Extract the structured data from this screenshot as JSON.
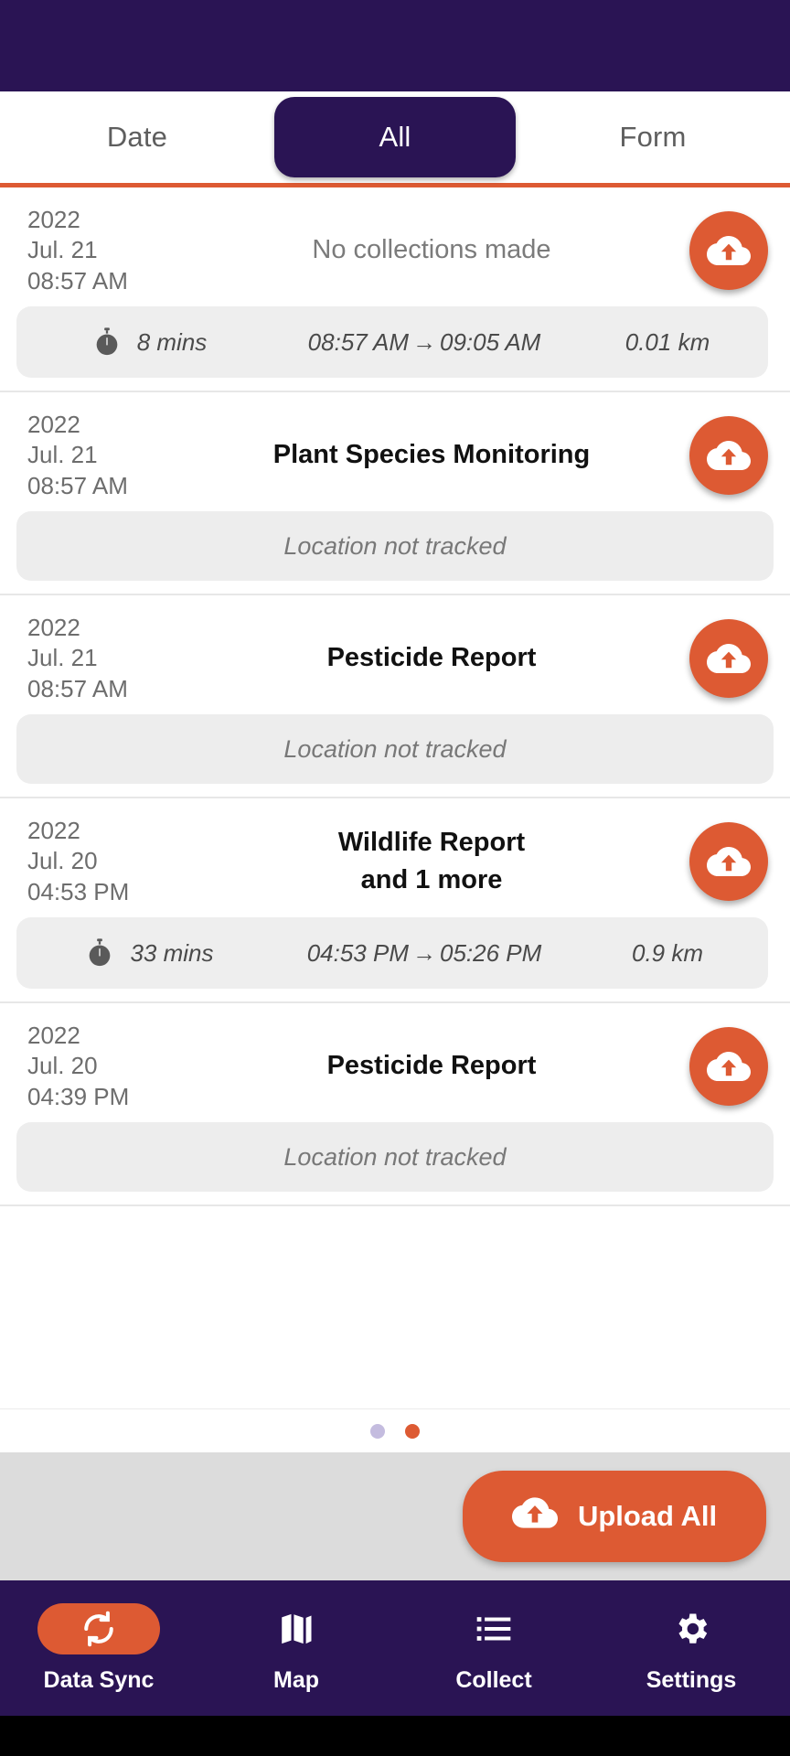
{
  "theme": {
    "primary": "#2a1454",
    "accent": "#dd5a33",
    "pill_bg": "#eeeeee",
    "bar_bg": "#dcdcdc",
    "muted_text": "#6d6d6d"
  },
  "tabs": [
    {
      "label": "Date",
      "active": false,
      "name": "tab-date"
    },
    {
      "label": "All",
      "active": true,
      "name": "tab-all"
    },
    {
      "label": "Form",
      "active": false,
      "name": "tab-form"
    }
  ],
  "records": [
    {
      "year": "2022",
      "date": "Jul. 21",
      "time": "08:57 AM",
      "title": "No collections made",
      "title_muted": true,
      "upload_icon": "cloud-upload-icon",
      "track": {
        "tracked": true,
        "icon": "stopwatch-icon",
        "duration": "8 mins",
        "start": "08:57 AM",
        "arrow": "→",
        "end": "09:05 AM",
        "distance": "0.01 km"
      }
    },
    {
      "year": "2022",
      "date": "Jul. 21",
      "time": "08:57 AM",
      "title": "Plant Species Monitoring",
      "title_muted": false,
      "upload_icon": "cloud-upload-icon",
      "track": {
        "tracked": false,
        "label": "Location not tracked"
      }
    },
    {
      "year": "2022",
      "date": "Jul. 21",
      "time": "08:57 AM",
      "title": "Pesticide Report",
      "title_muted": false,
      "upload_icon": "cloud-upload-icon",
      "track": {
        "tracked": false,
        "label": "Location not tracked"
      }
    },
    {
      "year": "2022",
      "date": "Jul. 20",
      "time": "04:53 PM",
      "title": "Wildlife Report",
      "title_line2": "and 1 more",
      "title_muted": false,
      "upload_icon": "cloud-upload-icon",
      "track": {
        "tracked": true,
        "icon": "stopwatch-icon",
        "duration": "33 mins",
        "start": "04:53 PM",
        "arrow": "→",
        "end": "05:26 PM",
        "distance": "0.9 km"
      }
    },
    {
      "year": "2022",
      "date": "Jul. 20",
      "time": "04:39 PM",
      "title": "Pesticide Report",
      "title_muted": false,
      "upload_icon": "cloud-upload-icon",
      "track": {
        "tracked": false,
        "label": "Location not tracked"
      }
    }
  ],
  "pager": {
    "count": 2,
    "active_index": 1
  },
  "upload_all": {
    "label": "Upload All",
    "icon": "cloud-upload-icon"
  },
  "bottom_nav": [
    {
      "label": "Data Sync",
      "icon": "sync-icon",
      "active": true,
      "name": "nav-data-sync"
    },
    {
      "label": "Map",
      "icon": "map-icon",
      "active": false,
      "name": "nav-map"
    },
    {
      "label": "Collect",
      "icon": "list-icon",
      "active": false,
      "name": "nav-collect"
    },
    {
      "label": "Settings",
      "icon": "gear-icon",
      "active": false,
      "name": "nav-settings"
    }
  ]
}
